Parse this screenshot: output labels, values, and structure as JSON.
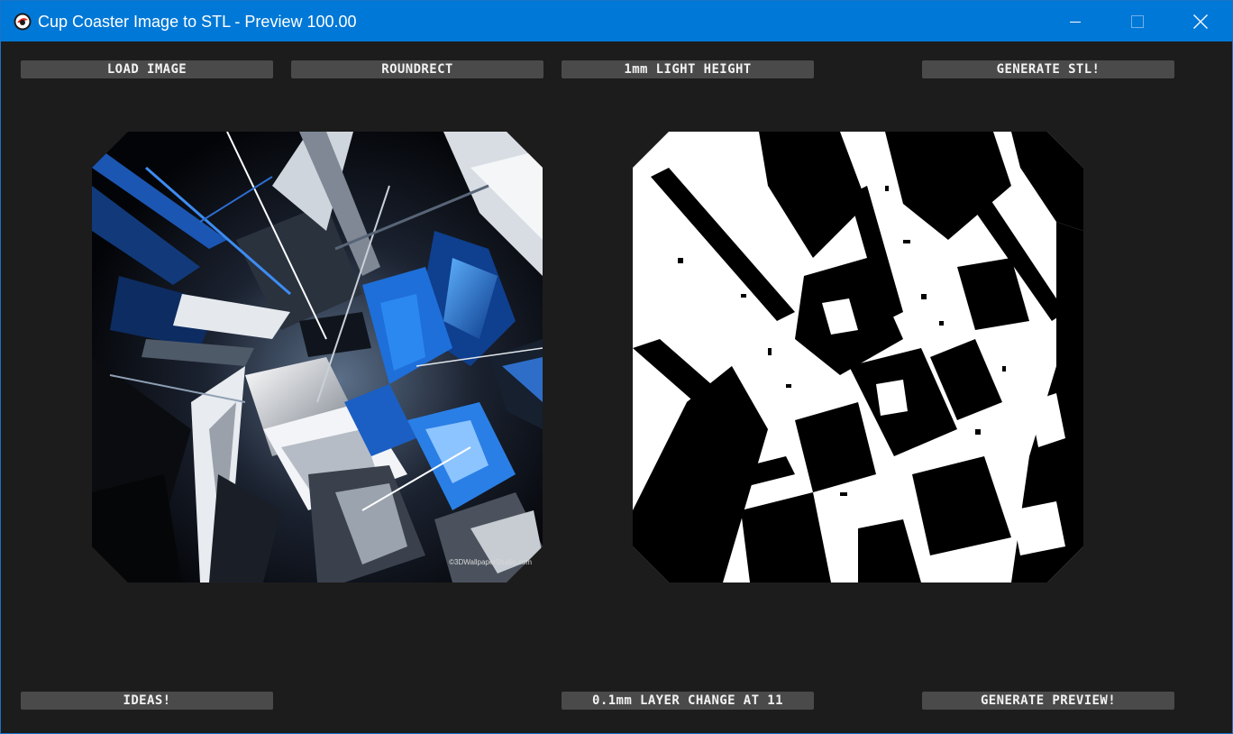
{
  "window": {
    "title": "Cup Coaster Image to STL - Preview 100.00",
    "app_icon": "app-logo-icon",
    "controls": {
      "minimize_icon": "minimize-icon",
      "maximize_icon": "maximize-icon",
      "close_icon": "close-icon"
    }
  },
  "toolbar_top": {
    "load_image": "LOAD IMAGE",
    "shape": "ROUNDRECT",
    "light_height": "1mm LIGHT HEIGHT",
    "generate_stl": "GENERATE STL!"
  },
  "toolbar_bottom": {
    "ideas": "IDEAS!",
    "layer_change": "0.1mm LAYER CHANGE AT 11",
    "generate_preview": "GENERATE PREVIEW!"
  },
  "images": {
    "source_watermark": "©3DWallpaperStudio.com"
  },
  "colors": {
    "titlebar": "#0078d7",
    "background": "#1c1c1c",
    "button": "#4a4a4a",
    "button_text": "#f2f2f2",
    "accent_blue": "#1e6fd9"
  }
}
